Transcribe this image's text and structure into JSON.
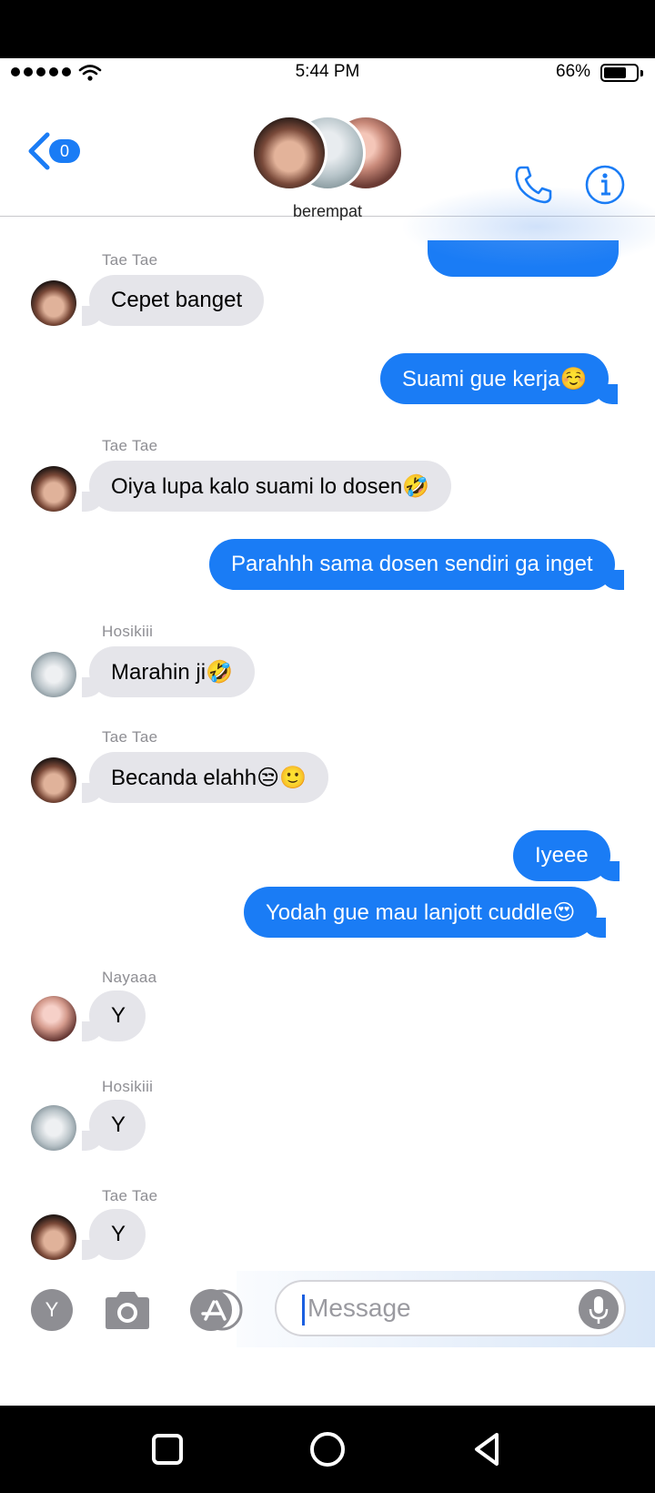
{
  "status": {
    "time": "5:44 PM",
    "battery": "66%"
  },
  "header": {
    "unread_count": "0",
    "group_name": "berempat"
  },
  "messages": [
    {
      "sender": "Tae Tae",
      "text": "Cepet banget"
    },
    {
      "text": "Suami gue kerja",
      "emoji": "☺️"
    },
    {
      "sender": "Tae Tae",
      "text": "Oiya lupa kalo suami lo dosen",
      "emoji": "🤣"
    },
    {
      "text": "Parahhh sama dosen sendiri ga inget"
    },
    {
      "sender": "Hosikiii",
      "text": "Marahin ji",
      "emoji": "🤣"
    },
    {
      "sender": "Tae Tae",
      "text": "Becanda elahh",
      "emoji": "😒🙂"
    },
    {
      "text": "Iyeee"
    },
    {
      "text": "Yodah gue mau lanjott cuddle",
      "emoji": "😍"
    },
    {
      "sender": "Nayaaa",
      "text": "Y"
    },
    {
      "sender": "Hosikiii",
      "text": "Y"
    },
    {
      "sender": "Tae Tae",
      "text": "Y"
    }
  ],
  "input": {
    "avatar_letter": "Y",
    "placeholder": "Message"
  },
  "colors": {
    "accent": "#1a7cf5",
    "incoming": "#e5e5ea"
  },
  "icons": [
    "wifi-icon",
    "back-chevron-icon",
    "phone-icon",
    "info-icon",
    "camera-icon",
    "app-store-icon",
    "microphone-icon",
    "recents-icon",
    "home-icon",
    "back-triangle-icon"
  ]
}
